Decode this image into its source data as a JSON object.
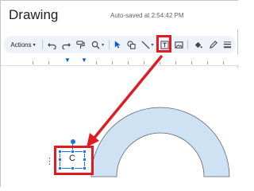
{
  "window": {
    "title": "Drawing",
    "autosave_text": "Auto-saved at 2:54:42 PM"
  },
  "toolbar": {
    "actions_label": "Actions",
    "buttons": [
      {
        "name": "undo-icon"
      },
      {
        "name": "redo-icon"
      },
      {
        "name": "paint-format-icon"
      },
      {
        "name": "zoom-icon"
      },
      {
        "name": "select-icon"
      },
      {
        "name": "shape-icon"
      },
      {
        "name": "line-icon"
      },
      {
        "name": "text-box-icon"
      },
      {
        "name": "image-icon"
      },
      {
        "name": "fill-color-icon"
      },
      {
        "name": "border-color-icon"
      },
      {
        "name": "border-weight-icon"
      }
    ]
  },
  "canvas": {
    "textbox_text": "C"
  },
  "colors": {
    "highlight": "#e01b24",
    "selection": "#1a73e8",
    "shape_fill": "#cfe2f3",
    "arrow": "#e01b24"
  }
}
